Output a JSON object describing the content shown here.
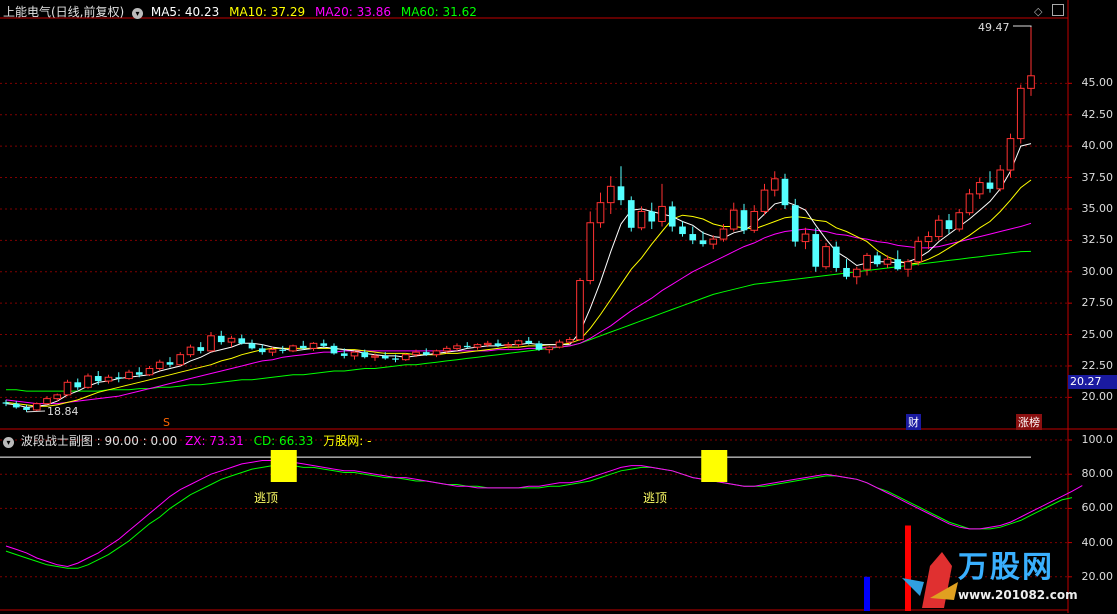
{
  "main_panel": {
    "title": "上能电气(日线,前复权)",
    "ma_labels": [
      {
        "label": "MA5: 40.23",
        "color": "#ffffff"
      },
      {
        "label": "MA10: 37.29",
        "color": "#ffff00"
      },
      {
        "label": "MA20: 33.86",
        "color": "#ff00ff"
      },
      {
        "label": "MA60: 31.62",
        "color": "#00ff00"
      }
    ],
    "price_ticks": [
      "45.00",
      "42.50",
      "40.00",
      "37.50",
      "35.00",
      "32.50",
      "30.00",
      "27.50",
      "25.00",
      "22.50",
      "20.00"
    ],
    "current_price_tag": "20.27",
    "high_label": "49.47",
    "low_label": "18.84",
    "markers": {
      "s_marker": "S",
      "cai_marker": "财",
      "zhangbang_marker": "涨榜"
    }
  },
  "sub_panel": {
    "title": "波段战士副图 : 90.00 : 0.00",
    "zx_label": "ZX: 73.31",
    "cd_label": "CD: 66.33",
    "wan_label": "万股网: -",
    "ticks": [
      "100.0",
      "80.00",
      "60.00",
      "40.00",
      "20.00"
    ],
    "escape_labels": [
      "逃顶",
      "逃顶"
    ]
  },
  "watermark": {
    "text": "万股网",
    "url": "www.201082.com"
  },
  "colors": {
    "up": "#ff3232",
    "down": "#54ffff",
    "ma5": "#ffffff",
    "ma10": "#ffff00",
    "ma20": "#ff00ff",
    "ma60": "#00ff00",
    "grid": "#800000",
    "axis": "#c00000",
    "escape_box": "#ffff00",
    "zx": "#ff00ff",
    "cd": "#00ff00"
  },
  "chart_data": {
    "type": "candlestick",
    "y_range": [
      18.84,
      49.47
    ],
    "ylim": [
      17.8,
      50.2
    ],
    "sub_ylim": [
      0,
      100
    ],
    "ohlc": [
      [
        19.6,
        19.8,
        19.3,
        19.5
      ],
      [
        19.5,
        19.7,
        19.1,
        19.2
      ],
      [
        19.2,
        19.4,
        18.84,
        19.0
      ],
      [
        19.0,
        19.6,
        18.9,
        19.5
      ],
      [
        19.5,
        20.1,
        19.4,
        19.9
      ],
      [
        19.9,
        20.3,
        19.7,
        20.2
      ],
      [
        20.2,
        21.4,
        20.1,
        21.2
      ],
      [
        21.2,
        21.5,
        20.6,
        20.8
      ],
      [
        20.8,
        21.9,
        20.7,
        21.7
      ],
      [
        21.7,
        22.1,
        21.0,
        21.3
      ],
      [
        21.3,
        21.8,
        21.1,
        21.6
      ],
      [
        21.6,
        22.0,
        21.2,
        21.5
      ],
      [
        21.5,
        22.2,
        21.4,
        22.0
      ],
      [
        22.0,
        22.4,
        21.6,
        21.8
      ],
      [
        21.8,
        22.5,
        21.7,
        22.3
      ],
      [
        22.3,
        23.0,
        22.1,
        22.8
      ],
      [
        22.8,
        23.2,
        22.4,
        22.6
      ],
      [
        22.6,
        23.6,
        22.5,
        23.4
      ],
      [
        23.4,
        24.2,
        23.2,
        24.0
      ],
      [
        24.0,
        24.4,
        23.5,
        23.7
      ],
      [
        23.7,
        25.2,
        23.6,
        24.9
      ],
      [
        24.9,
        25.3,
        24.2,
        24.4
      ],
      [
        24.4,
        24.9,
        24.0,
        24.7
      ],
      [
        24.7,
        25.0,
        24.2,
        24.3
      ],
      [
        24.3,
        24.6,
        23.8,
        23.9
      ],
      [
        23.9,
        24.2,
        23.4,
        23.6
      ],
      [
        23.6,
        24.0,
        23.3,
        23.8
      ],
      [
        23.8,
        24.1,
        23.5,
        23.7
      ],
      [
        23.7,
        24.2,
        23.6,
        24.1
      ],
      [
        24.1,
        24.5,
        23.8,
        23.9
      ],
      [
        23.9,
        24.4,
        23.7,
        24.3
      ],
      [
        24.3,
        24.6,
        24.0,
        24.1
      ],
      [
        24.1,
        24.3,
        23.4,
        23.5
      ],
      [
        23.5,
        23.9,
        23.1,
        23.3
      ],
      [
        23.3,
        23.7,
        23.0,
        23.6
      ],
      [
        23.6,
        23.8,
        23.1,
        23.2
      ],
      [
        23.2,
        23.5,
        22.9,
        23.3
      ],
      [
        23.3,
        23.6,
        23.0,
        23.1
      ],
      [
        23.1,
        23.4,
        22.8,
        23.0
      ],
      [
        23.0,
        23.5,
        22.9,
        23.4
      ],
      [
        23.4,
        23.8,
        23.2,
        23.6
      ],
      [
        23.6,
        23.9,
        23.3,
        23.4
      ],
      [
        23.4,
        23.8,
        23.2,
        23.7
      ],
      [
        23.7,
        24.1,
        23.5,
        23.9
      ],
      [
        23.9,
        24.3,
        23.7,
        24.1
      ],
      [
        24.1,
        24.4,
        23.9,
        24.0
      ],
      [
        24.0,
        24.3,
        23.8,
        24.2
      ],
      [
        24.2,
        24.5,
        24.0,
        24.3
      ],
      [
        24.3,
        24.6,
        24.0,
        24.1
      ],
      [
        24.1,
        24.4,
        23.9,
        24.2
      ],
      [
        24.2,
        24.6,
        24.0,
        24.5
      ],
      [
        24.5,
        24.8,
        24.2,
        24.3
      ],
      [
        24.3,
        24.5,
        23.7,
        23.8
      ],
      [
        23.8,
        24.1,
        23.5,
        24.0
      ],
      [
        24.0,
        24.6,
        23.9,
        24.4
      ],
      [
        24.4,
        24.8,
        24.2,
        24.6
      ],
      [
        24.6,
        29.5,
        24.5,
        29.3
      ],
      [
        29.3,
        34.8,
        29.0,
        33.9
      ],
      [
        33.9,
        36.3,
        33.5,
        35.5
      ],
      [
        35.5,
        37.6,
        34.6,
        36.8
      ],
      [
        36.8,
        38.4,
        35.3,
        35.7
      ],
      [
        35.7,
        36.0,
        33.2,
        33.5
      ],
      [
        33.5,
        35.2,
        33.3,
        34.8
      ],
      [
        34.8,
        35.5,
        33.4,
        34.0
      ],
      [
        34.0,
        37.0,
        33.6,
        35.2
      ],
      [
        35.2,
        35.6,
        33.2,
        33.6
      ],
      [
        33.6,
        34.0,
        32.8,
        33.0
      ],
      [
        33.0,
        33.6,
        32.2,
        32.5
      ],
      [
        32.5,
        33.2,
        32.0,
        32.2
      ],
      [
        32.2,
        32.9,
        31.8,
        32.6
      ],
      [
        32.6,
        33.8,
        32.4,
        33.4
      ],
      [
        33.4,
        35.5,
        33.2,
        34.9
      ],
      [
        34.9,
        35.4,
        33.0,
        33.3
      ],
      [
        33.3,
        35.3,
        33.1,
        34.8
      ],
      [
        34.8,
        37.0,
        34.5,
        36.5
      ],
      [
        36.5,
        38.0,
        36.0,
        37.4
      ],
      [
        37.4,
        37.8,
        35.0,
        35.3
      ],
      [
        35.3,
        35.8,
        32.0,
        32.4
      ],
      [
        32.4,
        33.5,
        31.8,
        33.0
      ],
      [
        33.0,
        33.5,
        30.0,
        30.4
      ],
      [
        30.4,
        32.3,
        30.2,
        32.0
      ],
      [
        32.0,
        32.4,
        30.0,
        30.3
      ],
      [
        30.3,
        31.0,
        29.4,
        29.6
      ],
      [
        29.6,
        30.4,
        29.0,
        30.2
      ],
      [
        30.2,
        31.5,
        29.7,
        31.3
      ],
      [
        31.3,
        31.6,
        30.4,
        30.6
      ],
      [
        30.6,
        31.3,
        30.3,
        31.0
      ],
      [
        31.0,
        31.7,
        30.1,
        30.2
      ],
      [
        30.2,
        31.0,
        29.6,
        30.8
      ],
      [
        30.8,
        32.8,
        30.5,
        32.4
      ],
      [
        32.4,
        33.2,
        31.8,
        32.8
      ],
      [
        32.8,
        34.5,
        32.5,
        34.1
      ],
      [
        34.1,
        34.6,
        33.0,
        33.4
      ],
      [
        33.4,
        35.0,
        33.2,
        34.7
      ],
      [
        34.7,
        36.6,
        34.5,
        36.2
      ],
      [
        36.2,
        37.5,
        35.8,
        37.1
      ],
      [
        37.1,
        38.0,
        36.3,
        36.6
      ],
      [
        36.6,
        38.5,
        36.4,
        38.1
      ],
      [
        38.1,
        41.0,
        37.5,
        40.6
      ],
      [
        40.6,
        44.9,
        40.2,
        44.6
      ],
      [
        44.6,
        49.47,
        44.0,
        45.6
      ]
    ],
    "ma5": [
      19.5,
      19.4,
      19.2,
      19.3,
      19.4,
      19.7,
      20.2,
      20.5,
      20.9,
      21.2,
      21.3,
      21.5,
      21.6,
      21.7,
      21.8,
      22.1,
      22.3,
      22.5,
      22.9,
      23.2,
      23.6,
      23.8,
      24.0,
      24.3,
      24.3,
      24.2,
      24.0,
      23.9,
      23.7,
      23.8,
      23.9,
      24.0,
      23.9,
      23.8,
      23.7,
      23.5,
      23.4,
      23.3,
      23.3,
      23.2,
      23.3,
      23.4,
      23.5,
      23.6,
      23.7,
      23.9,
      24.0,
      24.1,
      24.1,
      24.2,
      24.2,
      24.3,
      24.2,
      24.2,
      24.2,
      24.2,
      25.2,
      27.1,
      29.2,
      31.6,
      33.8,
      34.9,
      35.0,
      34.8,
      34.6,
      34.4,
      34.0,
      33.7,
      33.1,
      32.8,
      32.7,
      33.1,
      33.3,
      33.8,
      34.6,
      35.4,
      35.6,
      35.3,
      34.9,
      33.7,
      32.6,
      31.6,
      31.1,
      30.5,
      30.7,
      30.8,
      30.8,
      30.7,
      30.8,
      31.1,
      31.6,
      32.4,
      33.0,
      33.6,
      34.2,
      34.9,
      35.6,
      36.6,
      38.0,
      40.0,
      40.2
    ],
    "ma10": [
      19.6,
      19.5,
      19.4,
      19.3,
      19.3,
      19.4,
      19.6,
      19.8,
      20.1,
      20.4,
      20.6,
      20.8,
      21.0,
      21.2,
      21.4,
      21.6,
      21.8,
      22.0,
      22.2,
      22.4,
      22.6,
      22.9,
      23.1,
      23.4,
      23.6,
      23.8,
      23.9,
      23.9,
      23.9,
      23.9,
      23.9,
      23.9,
      23.9,
      23.8,
      23.8,
      23.7,
      23.6,
      23.5,
      23.5,
      23.5,
      23.4,
      23.4,
      23.4,
      23.5,
      23.5,
      23.6,
      23.7,
      23.8,
      23.9,
      24.0,
      24.0,
      24.1,
      24.1,
      24.2,
      24.2,
      24.3,
      24.6,
      25.5,
      26.6,
      27.8,
      29.0,
      30.2,
      31.1,
      32.2,
      33.2,
      34.2,
      34.5,
      34.4,
      34.2,
      33.8,
      33.6,
      33.6,
      33.5,
      33.4,
      33.7,
      34.0,
      34.3,
      34.4,
      34.3,
      34.1,
      34.0,
      33.5,
      33.2,
      32.8,
      32.4,
      31.7,
      31.2,
      30.9,
      30.6,
      30.7,
      31.0,
      31.4,
      31.9,
      32.4,
      32.9,
      33.5,
      34.0,
      34.8,
      35.7,
      36.7,
      37.3
    ],
    "ma20": [
      19.8,
      19.7,
      19.6,
      19.5,
      19.5,
      19.5,
      19.6,
      19.7,
      19.8,
      19.9,
      20.0,
      20.1,
      20.3,
      20.5,
      20.7,
      20.9,
      21.1,
      21.3,
      21.5,
      21.7,
      21.9,
      22.1,
      22.3,
      22.5,
      22.7,
      22.9,
      23.0,
      23.2,
      23.3,
      23.4,
      23.5,
      23.6,
      23.6,
      23.7,
      23.7,
      23.7,
      23.7,
      23.7,
      23.7,
      23.7,
      23.7,
      23.7,
      23.7,
      23.7,
      23.7,
      23.7,
      23.7,
      23.7,
      23.8,
      23.8,
      23.8,
      23.9,
      23.9,
      24.0,
      24.0,
      24.1,
      24.3,
      24.7,
      25.2,
      25.7,
      26.3,
      26.9,
      27.4,
      27.9,
      28.5,
      29.0,
      29.5,
      30.0,
      30.4,
      30.8,
      31.2,
      31.6,
      32.0,
      32.3,
      32.7,
      33.0,
      33.2,
      33.3,
      33.4,
      33.3,
      33.2,
      33.0,
      32.9,
      32.7,
      32.6,
      32.4,
      32.3,
      32.1,
      32.0,
      31.9,
      31.9,
      32.0,
      32.2,
      32.4,
      32.6,
      32.8,
      33.0,
      33.2,
      33.4,
      33.6,
      33.86
    ],
    "ma60": [
      20.6,
      20.6,
      20.5,
      20.5,
      20.5,
      20.5,
      20.5,
      20.5,
      20.5,
      20.5,
      20.6,
      20.6,
      20.6,
      20.7,
      20.7,
      20.8,
      20.8,
      20.9,
      21.0,
      21.0,
      21.1,
      21.2,
      21.3,
      21.4,
      21.4,
      21.5,
      21.6,
      21.7,
      21.8,
      21.8,
      21.9,
      22.0,
      22.1,
      22.1,
      22.2,
      22.3,
      22.3,
      22.4,
      22.5,
      22.6,
      22.6,
      22.7,
      22.8,
      22.9,
      23.0,
      23.1,
      23.2,
      23.3,
      23.4,
      23.5,
      23.6,
      23.7,
      23.8,
      23.9,
      24.0,
      24.1,
      24.3,
      24.6,
      24.9,
      25.2,
      25.5,
      25.8,
      26.1,
      26.4,
      26.7,
      27.0,
      27.3,
      27.6,
      27.9,
      28.2,
      28.4,
      28.6,
      28.8,
      29.0,
      29.1,
      29.2,
      29.3,
      29.4,
      29.5,
      29.6,
      29.7,
      29.8,
      29.9,
      30.0,
      30.1,
      30.2,
      30.3,
      30.4,
      30.5,
      30.6,
      30.7,
      30.8,
      30.9,
      31.0,
      31.1,
      31.2,
      31.3,
      31.4,
      31.5,
      31.6,
      31.62
    ],
    "zx": [
      38,
      36,
      34,
      31,
      29,
      27,
      26,
      28,
      31,
      34,
      38,
      42,
      47,
      52,
      57,
      62,
      67,
      71,
      74,
      77,
      80,
      82,
      84,
      86,
      87,
      88,
      88,
      88,
      87,
      86,
      85,
      84,
      83,
      82,
      82,
      81,
      80,
      79,
      78,
      78,
      77,
      76,
      75,
      74,
      73,
      73,
      72,
      72,
      72,
      72,
      72,
      73,
      73,
      74,
      75,
      75,
      76,
      78,
      80,
      82,
      84,
      85,
      85,
      84,
      83,
      82,
      80,
      78,
      77,
      76,
      75,
      74,
      73,
      73,
      74,
      75,
      76,
      77,
      78,
      79,
      80,
      79,
      78,
      77,
      75,
      72,
      69,
      66,
      63,
      60,
      57,
      54,
      51,
      49,
      48,
      48,
      49,
      50,
      52,
      55,
      58,
      61,
      64,
      67,
      70,
      73.31
    ],
    "cd": [
      35,
      33,
      31,
      29,
      27,
      26,
      25,
      25,
      27,
      30,
      33,
      37,
      41,
      46,
      51,
      55,
      60,
      64,
      68,
      71,
      74,
      77,
      79,
      81,
      83,
      84,
      85,
      85,
      85,
      84,
      84,
      83,
      82,
      81,
      81,
      80,
      79,
      78,
      78,
      77,
      76,
      76,
      75,
      74,
      74,
      73,
      73,
      72,
      72,
      72,
      72,
      72,
      72,
      73,
      73,
      74,
      75,
      76,
      78,
      80,
      82,
      83,
      84,
      84,
      83,
      82,
      80,
      78,
      77,
      76,
      75,
      74,
      73,
      73,
      73,
      74,
      75,
      76,
      77,
      78,
      79,
      79,
      78,
      77,
      75,
      72,
      70,
      67,
      64,
      61,
      58,
      55,
      52,
      50,
      48,
      48,
      48,
      49,
      51,
      53,
      56,
      59,
      62,
      65,
      66.33
    ],
    "white_line_value": 90,
    "escape_boxes": [
      {
        "x_index": 27
      },
      {
        "x_index": 69
      }
    ],
    "bars": [
      {
        "x_index": 88,
        "value": 50,
        "color": "#ff0000"
      },
      {
        "x_index": 84,
        "value": 20,
        "color": "#0000ff"
      }
    ]
  }
}
